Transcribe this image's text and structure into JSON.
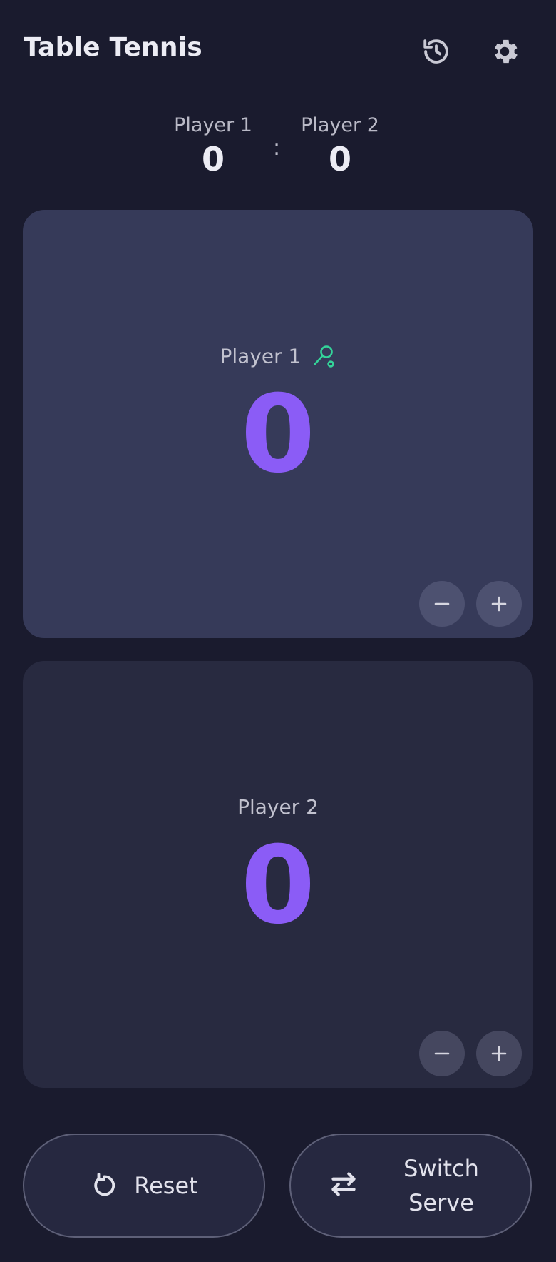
{
  "header": {
    "title": "Table Tennis",
    "history_icon": "history-icon",
    "settings_icon": "gear-icon"
  },
  "summary": {
    "player1_name": "Player 1",
    "player1_score": "0",
    "separator": ":",
    "player2_name": "Player 2",
    "player2_score": "0"
  },
  "panels": [
    {
      "name": "Player 1",
      "score": "0",
      "serving": true,
      "serve_icon": "racket-icon",
      "minus_label": "−",
      "plus_label": "+"
    },
    {
      "name": "Player 2",
      "score": "0",
      "serving": false,
      "minus_label": "−",
      "plus_label": "+"
    }
  ],
  "actions": {
    "reset_label": "Reset",
    "reset_icon": "reset-icon",
    "switch_line1": "Switch",
    "switch_line2": "Serve",
    "switch_icon": "swap-arrows-icon"
  },
  "colors": {
    "background": "#1a1b2e",
    "active_panel": "#363a59",
    "inactive_panel": "#282a40",
    "score_accent": "#8b5cf6",
    "serve_indicator": "#34d399"
  }
}
